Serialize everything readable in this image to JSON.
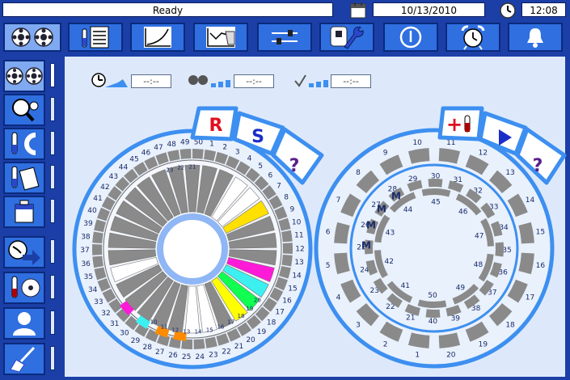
{
  "status": {
    "text": "Ready",
    "date": "10/13/2010",
    "time": "12:08"
  },
  "timers": {
    "field1": "--:--",
    "field2": "--:--",
    "field3": "--:--"
  },
  "reagent_tabs": {
    "r": "R",
    "s": "S",
    "help": "?"
  },
  "sample_tabs": {
    "add": "+",
    "help": "?"
  },
  "colors": {
    "background": "#dde9fb",
    "frame": "#1b3fa6",
    "button": "#2f6fe0",
    "ring": "#3d8ff0",
    "position_gray": "#8a8a8a"
  },
  "icons": [
    "tray-icon",
    "worklist-icon",
    "calibration-curve-icon",
    "qc-chart-icon",
    "settings-sliders-icon",
    "maintenance-icon",
    "power-icon",
    "alarm-clock-icon",
    "bell-icon",
    "reagent-tray-icon",
    "search-icon",
    "sample-tray-icon",
    "clipboard-icon",
    "cube-icon",
    "run-clock-icon",
    "tubes-icon",
    "user-icon",
    "cleaning-icon",
    "calendar-icon",
    "clock-icon"
  ],
  "reagent_tray": {
    "outer_labels": [
      "1",
      "2",
      "3",
      "4",
      "5",
      "6",
      "7",
      "8",
      "9",
      "10",
      "11",
      "12",
      "13",
      "14",
      "15",
      "16",
      "17",
      "18",
      "19",
      "20",
      "21",
      "22",
      "23",
      "24",
      "25",
      "26",
      "27",
      "28",
      "29",
      "30",
      "31",
      "32",
      "33",
      "34",
      "35",
      "36",
      "37",
      "38",
      "39",
      "40",
      "41",
      "42",
      "43",
      "44",
      "45",
      "46",
      "47",
      "48",
      "49",
      "50"
    ],
    "visible_inner_labels": [
      "23",
      "22",
      "21",
      "10",
      "11",
      "12",
      "13",
      "14",
      "15",
      "16",
      "17",
      "18",
      "19",
      "20"
    ]
  },
  "sample_tray": {
    "outer_labels": [
      "1",
      "2",
      "3",
      "4",
      "5",
      "6",
      "7",
      "8",
      "9",
      "10",
      "11",
      "12",
      "13",
      "14",
      "15",
      "16",
      "17",
      "18",
      "19",
      "20"
    ],
    "middle_labels": [
      "21",
      "22",
      "23",
      "24",
      "25",
      "26",
      "27",
      "28",
      "29",
      "30",
      "31",
      "32",
      "33",
      "34",
      "35",
      "36",
      "37",
      "38",
      "39",
      "40"
    ],
    "inner_labels": [
      "41",
      "42",
      "43",
      "44",
      "45",
      "46",
      "47",
      "48",
      "49",
      "50"
    ],
    "markers": [
      "M",
      "M",
      "M",
      "M"
    ]
  }
}
